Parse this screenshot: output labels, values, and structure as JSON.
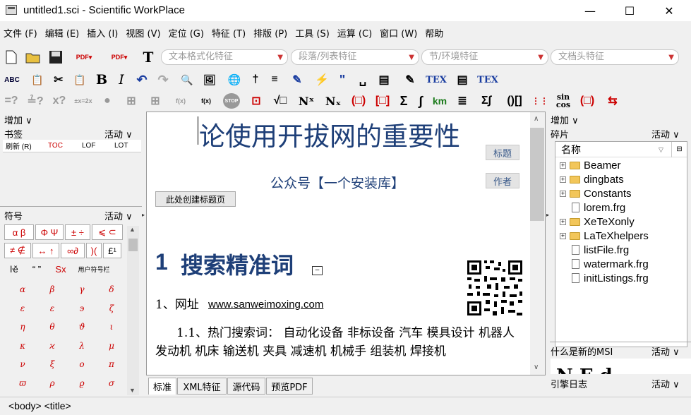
{
  "window": {
    "title": "untitled1.sci - Scientific WorkPlace",
    "minimize": "—",
    "maximize": "☐",
    "close": "✕"
  },
  "menu": [
    "文件 (F)",
    "编辑 (E)",
    "插入 (I)",
    "视图 (V)",
    "定位 (G)",
    "特征 (T)",
    "排版 (P)",
    "工具 (S)",
    "运算 (C)",
    "窗口 (W)",
    "帮助"
  ],
  "toolbar": {
    "combos": [
      "文本格式化特征",
      "段落/列表特征",
      "节/环境特征",
      "文档头特征"
    ],
    "row2": [
      "ABC",
      "📋",
      "✂",
      "📋",
      "B",
      "I",
      "↶",
      "↷",
      "🔍",
      "🖼",
      "🌐",
      "†",
      "≡",
      "✎",
      "⚡",
      "\"",
      "␣",
      "▤",
      "✎",
      "TEX",
      "▤",
      "TEX"
    ],
    "row3": [
      "=?",
      "≟?",
      "x?",
      "±x=2x",
      "●",
      "⊞",
      "⊞",
      "f(x)",
      "f(x)",
      "STOP",
      "⊡",
      "√□",
      "Nˣ",
      "Nₓ",
      "(□)",
      "[□]",
      "Σ",
      "∫",
      "km",
      "≣",
      "Σ∫",
      "()[]",
      "⋮⋮",
      "sin cos",
      "(□)",
      "⇆"
    ]
  },
  "left_panel": {
    "add_label": "增加 ∨",
    "bookmarks": {
      "label": "书签",
      "active": "活动 ∨",
      "tabs": [
        "刷新 (R)",
        "TOC",
        "LOF",
        "LOT"
      ]
    },
    "symbols": {
      "label": "符号",
      "active": "活动 ∨",
      "tabs_row1": [
        "α β",
        "Φ Ψ",
        "± ÷",
        "⩽ ⊂"
      ],
      "tabs_row2": [
        "≠ ∉",
        "↔ ↑",
        "∞∂",
        ")(",
        "£¹"
      ],
      "tabs_row3": [
        "ŀě",
        "“ ”",
        "Sx",
        "用户符号栏"
      ],
      "greek": [
        "α",
        "β",
        "γ",
        "δ",
        "ε",
        "ε",
        "϶",
        "ζ",
        "η",
        "θ",
        "ϑ",
        "ι",
        "κ",
        "ϰ",
        "λ",
        "μ",
        "ν",
        "ξ",
        "ο",
        "π",
        "ϖ",
        "ρ",
        "ϱ",
        "σ"
      ]
    }
  },
  "document": {
    "title": "论使用开拔网的重要性",
    "title_tag": "标题",
    "author": "公众号【一个安装库】",
    "author_tag": "作者",
    "create_title_btn": "此处创建标题页",
    "section_num": "1",
    "section_title": "搜索精准词",
    "line1_prefix": "1、网址",
    "line1_url": "www.sanweimoxing.com",
    "para": "1.1、热门搜索词： 自动化设备 非标设备 汽车 模具设计 机器人 发动机 机床 输送机 夹具 减速机 机械手 组装机 焊接机"
  },
  "bottom_tabs": [
    "标准",
    "XML特征",
    "源代码",
    "预览PDF"
  ],
  "right_panel": {
    "add_label": "增加 ∨",
    "fragments": {
      "label": "碎片",
      "active": "活动 ∨",
      "col_name": "名称"
    },
    "tree": [
      {
        "type": "folder",
        "name": "Beamer"
      },
      {
        "type": "folder",
        "name": "dingbats"
      },
      {
        "type": "folder",
        "name": "Constants"
      },
      {
        "type": "file",
        "name": "lorem.frg"
      },
      {
        "type": "folder",
        "name": "XeTeXonly"
      },
      {
        "type": "folder",
        "name": "LaTeXhelpers"
      },
      {
        "type": "file",
        "name": "listFile.frg"
      },
      {
        "type": "file",
        "name": "watermark.frg"
      },
      {
        "type": "file",
        "name": "initListings.frg"
      }
    ],
    "whatsnew": {
      "label": "什么是新的MSI",
      "active": "活动 ∨"
    },
    "log": {
      "label": "引擎日志",
      "active": "活动 ∨"
    }
  },
  "status": "<body> <title>"
}
